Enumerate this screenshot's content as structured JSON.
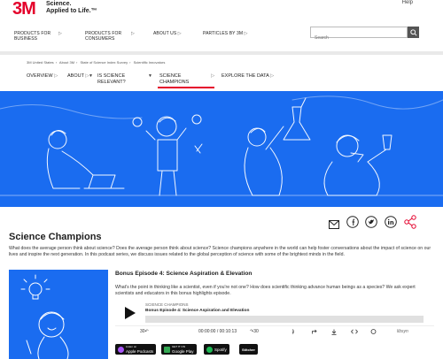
{
  "header": {
    "logo_text": "3M",
    "tagline_line1": "Science.",
    "tagline_line2": "Applied to Life.™",
    "help_label": "Help"
  },
  "mainnav": {
    "items": [
      {
        "label_line1": "PRODUCTS FOR",
        "label_line2": "BUSINESS"
      },
      {
        "label_line1": "PRODUCTS FOR",
        "label_line2": "CONSUMERS"
      },
      {
        "label_line1": "ABOUT US",
        "label_line2": ""
      },
      {
        "label_line1": "PARTICLES BY 3M",
        "label_line2": ""
      }
    ],
    "arrow": "▷"
  },
  "search": {
    "placeholder": "Search"
  },
  "breadcrumb": {
    "items": [
      "3M United States",
      "About 3M",
      "State of Science Index Survey",
      "Scientific Innovators"
    ],
    "separator": "›"
  },
  "subnav": {
    "items": [
      {
        "line1": "OVERVIEW",
        "line2": ""
      },
      {
        "line1": "ABOUT",
        "line2": ""
      },
      {
        "line1": "IS SCIENCE",
        "line2": "RELEVANT?"
      },
      {
        "line1": "SCIENCE",
        "line2": "CHAMPIONS"
      },
      {
        "line1": "EXPLORE THE DATA",
        "line2": ""
      }
    ],
    "arrow": "▷",
    "down": "▼"
  },
  "page": {
    "title": "Science Champions",
    "intro": "What does the average person think about science? Does the average person think about science? Science champions anywhere in the world can help foster conversations about the impact of science on our lives and inspire the next generation. In this podcast series, we discuss issues related to the global perception of science with some of the brightest minds in the field."
  },
  "episode": {
    "title": "Bonus Episode 4: Science Aspiration & Elevation",
    "description": "What's the point in thinking like a scientist, even if you're not one? How does scientific thinking advance human beings as a species? We ask expert scientists and educators in this bonus highlights episode."
  },
  "player": {
    "series": "SCIENCE CHAMPIONS",
    "episode_title": "Bonus Episode 4: Science Aspiration and Elevation",
    "rewind": "30↶",
    "time": "00:00:00 / 00:10:13",
    "forward": "↷30",
    "brand": "libsyn"
  },
  "badges": {
    "apple_small": "Listen on",
    "apple": "Apple Podcasts",
    "google_small": "GET IT ON",
    "google": "Google Play",
    "spotify": "Spotify",
    "stitcher": "Stitcher"
  },
  "colors": {
    "brand_red": "#e4002b",
    "hero_blue": "#1a6cf0"
  }
}
